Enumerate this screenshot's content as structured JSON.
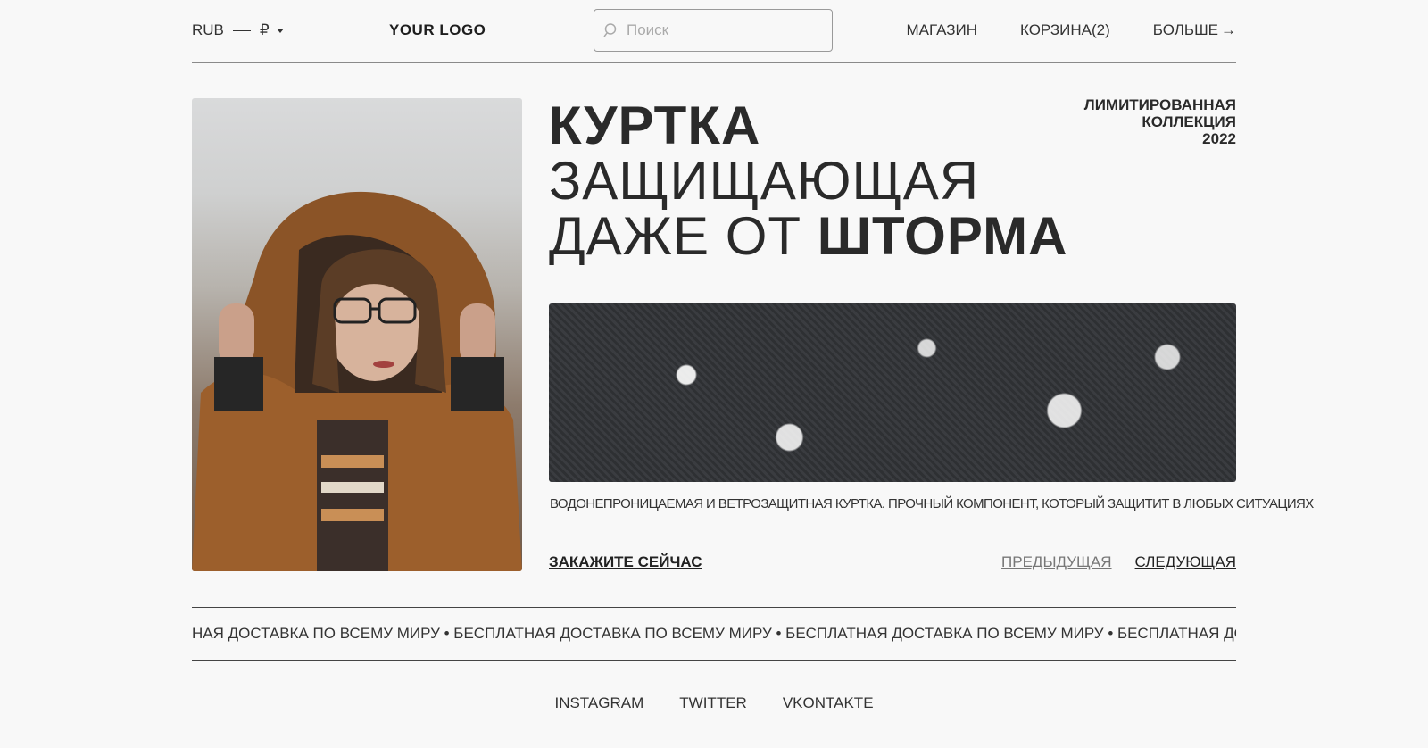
{
  "header": {
    "currency_code": "RUB",
    "currency_symbol": "₽",
    "logo": "YOUR LOGO",
    "search_placeholder": "Поиск",
    "nav": {
      "shop": "МАГАЗИН",
      "cart": "КОРЗИНА(2)",
      "more": "БОЛЬШЕ",
      "more_arrow": "→"
    }
  },
  "hero": {
    "title_line1": "КУРТКА",
    "title_line2": "ЗАЩИЩАЮЩАЯ",
    "title_line3_light": "ДАЖЕ ОТ ",
    "title_line3_bold": "ШТОРМА",
    "limited_line1": "ЛИМИТИРОВАННАЯ",
    "limited_line2": "КОЛЛЕКЦИЯ",
    "limited_line3": "2022",
    "description": "ВОДОНЕПРОНИЦАЕМАЯ И ВЕТРОЗАЩИТНАЯ КУРТКА. ПРОЧНЫЙ КОМПОНЕНТ, КОТОРЫЙ ЗАЩИТИТ В ЛЮБЫХ СИТУАЦИЯХ",
    "order_label": "ЗАКАЖИТЕ СЕЙЧАС",
    "prev_label": "ПРЕДЫДУЩАЯ",
    "next_label": "СЛЕДУЮЩАЯ"
  },
  "marquee": {
    "text": "НАЯ ДОСТАВКА ПО ВСЕМУ МИРУ • БЕСПЛАТНАЯ ДОСТАВКА ПО ВСЕМУ МИРУ • БЕСПЛАТНАЯ ДОСТАВКА ПО ВСЕМУ МИРУ •  БЕСПЛАТНАЯ ДОСТАВК"
  },
  "socials": {
    "instagram": "INSTAGRAM",
    "twitter": "TWITTER",
    "vkontakte": "VKONTAKTE"
  }
}
